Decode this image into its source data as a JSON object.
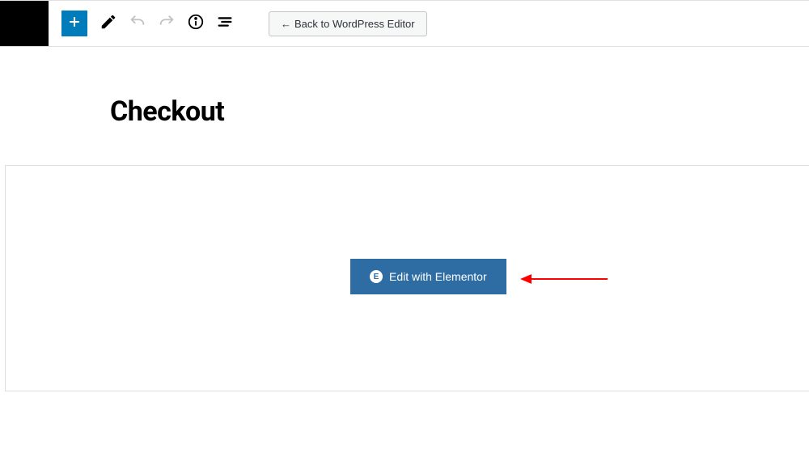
{
  "toolbar": {
    "back_button_label": "Back to WordPress Editor"
  },
  "page": {
    "title": "Checkout"
  },
  "editor": {
    "elementor_button_label": "Edit with Elementor"
  },
  "colors": {
    "add_block_bg": "#007cba",
    "elementor_button_bg": "#2e6da4",
    "annotation_arrow": "#ff0000"
  }
}
